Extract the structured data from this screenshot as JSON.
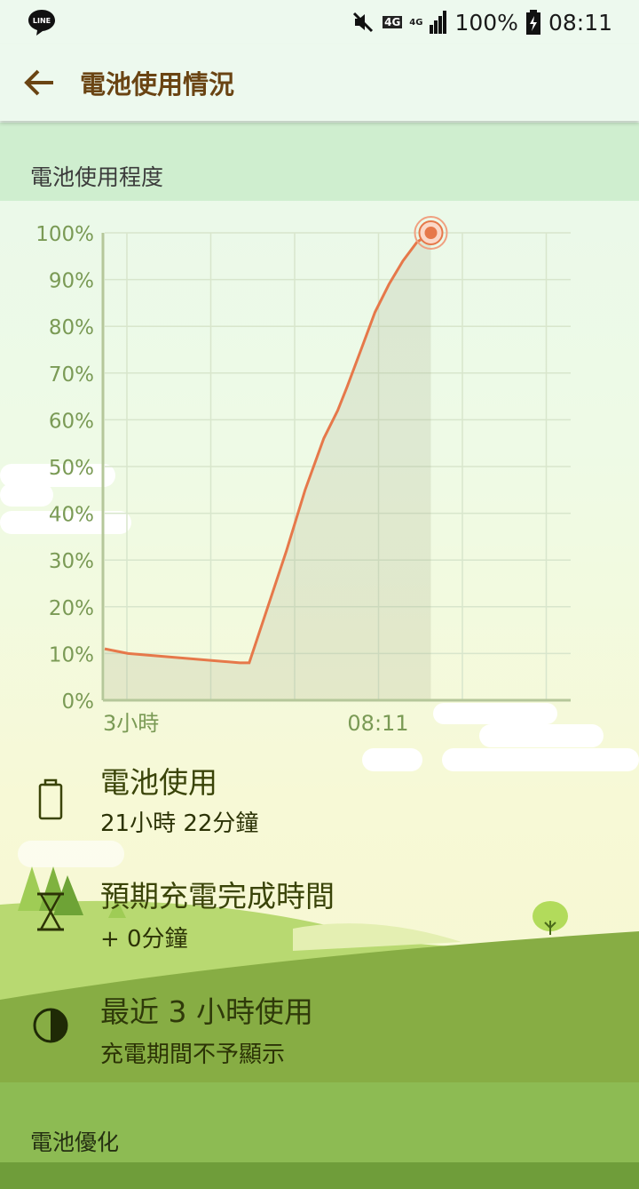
{
  "status_bar": {
    "battery_percent": "100%",
    "time": "08:11",
    "network_label": "4G",
    "network_label2": "4G",
    "icons": [
      "line-app-icon",
      "mute-icon",
      "4g-data-icon",
      "signal-icon",
      "battery-charging-icon"
    ]
  },
  "app_bar": {
    "title": "電池使用情況",
    "back_icon": "arrow-left-icon"
  },
  "usage_section": {
    "header": "電池使用程度"
  },
  "chart_data": {
    "type": "area",
    "title": "",
    "y_ticks": [
      "100%",
      "90%",
      "80%",
      "70%",
      "60%",
      "50%",
      "40%",
      "30%",
      "20%",
      "10%",
      "0%"
    ],
    "x_labels": [
      "3小時",
      "08:11"
    ],
    "ylim": [
      0,
      100
    ],
    "grid": true,
    "series": [
      {
        "color": "#e6784a",
        "points": [
          [
            0.0,
            11
          ],
          [
            0.05,
            10
          ],
          [
            0.29,
            8
          ],
          [
            0.31,
            8
          ],
          [
            0.35,
            20
          ],
          [
            0.39,
            32
          ],
          [
            0.43,
            45
          ],
          [
            0.47,
            56
          ],
          [
            0.5,
            62
          ],
          [
            0.52,
            67
          ],
          [
            0.55,
            75
          ],
          [
            0.58,
            83
          ],
          [
            0.61,
            89
          ],
          [
            0.64,
            94
          ],
          [
            0.67,
            98
          ],
          [
            0.7,
            100
          ]
        ]
      }
    ]
  },
  "rows": [
    {
      "icon": "battery-icon",
      "title": "電池使用",
      "subtitle": "21小時 22分鐘"
    },
    {
      "icon": "hourglass-icon",
      "title": "預期充電完成時間",
      "subtitle": "+ 0分鐘"
    },
    {
      "icon": "half-circle-icon",
      "title": "最近 3 小時使用",
      "subtitle": "充電期間不予顯示"
    }
  ],
  "optimization_section": {
    "header": "電池優化"
  },
  "colors": {
    "title": "#6a4413",
    "line": "#e6784a",
    "axis_text": "#7a9a55",
    "section": "#cfeecf"
  }
}
